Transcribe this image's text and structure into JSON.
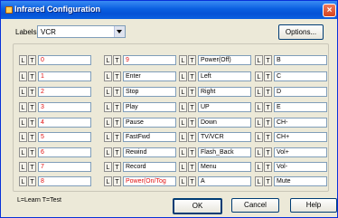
{
  "window": {
    "title": "Infrared Configuration",
    "close_label": "×"
  },
  "labels_field": {
    "label": "Labels:",
    "value": "VCR"
  },
  "options_label": "Options...",
  "learn_label": "L",
  "test_label": "T",
  "columns": [
    [
      "0",
      "1",
      "2",
      "3",
      "4",
      "5",
      "6",
      "7",
      "8"
    ],
    [
      "9",
      "Enter",
      "Stop",
      "Play",
      "Pause",
      "FastFwd",
      "Rewind",
      "Record",
      "Power(On/Tog"
    ],
    [
      "Power(Off)",
      "Left",
      "Right",
      "UP",
      "Down",
      "TV/VCR",
      "Flash_Back",
      "Menu",
      "A"
    ],
    [
      "B",
      "C",
      "D",
      "E",
      "CH-",
      "CH+",
      "Vol+",
      "Vol-",
      "Mute"
    ]
  ],
  "red_columns": [
    true,
    false,
    false,
    false
  ],
  "red_extra": [
    [
      1,
      0
    ],
    [
      1,
      8
    ]
  ],
  "legend": "L=Learn T=Test",
  "buttons": {
    "ok": "OK",
    "cancel": "Cancel",
    "help": "Help"
  },
  "colors": {
    "titlebar": "#0a5fe0",
    "highlight_text": "#e01010",
    "dialog_bg": "#ece9d8"
  }
}
